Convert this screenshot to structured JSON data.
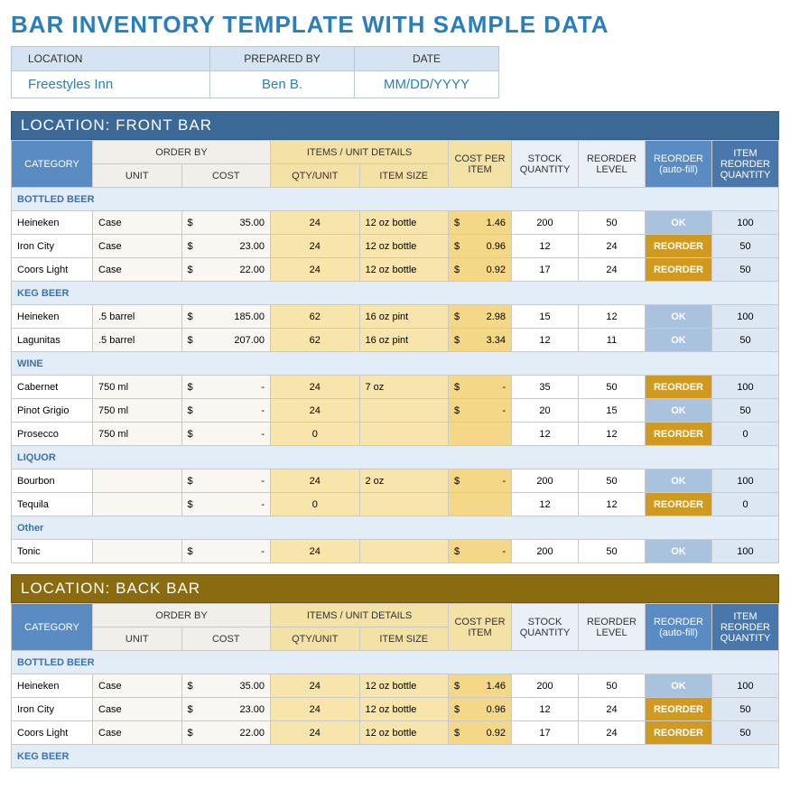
{
  "title": "BAR INVENTORY TEMPLATE WITH SAMPLE DATA",
  "meta": {
    "headers": {
      "location": "LOCATION",
      "prepared": "PREPARED BY",
      "date": "DATE"
    },
    "values": {
      "location": "Freestyles Inn",
      "prepared": "Ben B.",
      "date": "MM/DD/YYYY"
    }
  },
  "cols": {
    "category": "CATEGORY",
    "orderby": "ORDER BY",
    "unit": "UNIT",
    "cost": "COST",
    "items": "ITEMS / UNIT DETAILS",
    "qtyunit": "QTY/UNIT",
    "itemsize": "ITEM SIZE",
    "costper": "COST PER ITEM",
    "stock": "STOCK QUANTITY",
    "reorder": "REORDER LEVEL",
    "auto": "REORDER (auto-fill)",
    "irq": "ITEM REORDER QUANTITY"
  },
  "status": {
    "ok": "OK",
    "reorder": "REORDER"
  },
  "currency": "$",
  "locations": [
    {
      "title": "LOCATION: FRONT BAR",
      "style": "blue",
      "groups": [
        {
          "name": "BOTTLED BEER",
          "rows": [
            {
              "name": "Heineken",
              "unit": "Case",
              "cost": "35.00",
              "qty": "24",
              "size": "12 oz bottle",
              "cpi": "1.46",
              "stock": "200",
              "rlevel": "50",
              "auto": "OK",
              "irq": "100"
            },
            {
              "name": "Iron City",
              "unit": "Case",
              "cost": "23.00",
              "qty": "24",
              "size": "12 oz bottle",
              "cpi": "0.96",
              "stock": "12",
              "rlevel": "24",
              "auto": "REORDER",
              "irq": "50"
            },
            {
              "name": "Coors Light",
              "unit": "Case",
              "cost": "22.00",
              "qty": "24",
              "size": "12 oz bottle",
              "cpi": "0.92",
              "stock": "17",
              "rlevel": "24",
              "auto": "REORDER",
              "irq": "50"
            }
          ]
        },
        {
          "name": "KEG BEER",
          "rows": [
            {
              "name": "Heineken",
              "unit": ".5 barrel",
              "cost": "185.00",
              "qty": "62",
              "size": "16 oz pint",
              "cpi": "2.98",
              "stock": "15",
              "rlevel": "12",
              "auto": "OK",
              "irq": "100"
            },
            {
              "name": "Lagunitas",
              "unit": ".5 barrel",
              "cost": "207.00",
              "qty": "62",
              "size": "16 oz pint",
              "cpi": "3.34",
              "stock": "12",
              "rlevel": "11",
              "auto": "OK",
              "irq": "50"
            }
          ]
        },
        {
          "name": "WINE",
          "rows": [
            {
              "name": "Cabernet",
              "unit": "750 ml",
              "cost": "-",
              "qty": "24",
              "size": "7 oz",
              "cpi": "-",
              "stock": "35",
              "rlevel": "50",
              "auto": "REORDER",
              "irq": "100"
            },
            {
              "name": "Pinot Grigio",
              "unit": "750 ml",
              "cost": "-",
              "qty": "24",
              "size": "",
              "cpi": "-",
              "stock": "20",
              "rlevel": "15",
              "auto": "OK",
              "irq": "50"
            },
            {
              "name": "Prosecco",
              "unit": "750 ml",
              "cost": "-",
              "qty": "0",
              "size": "",
              "cpi": "",
              "stock": "12",
              "rlevel": "12",
              "auto": "REORDER",
              "irq": "0"
            }
          ]
        },
        {
          "name": "LIQUOR",
          "rows": [
            {
              "name": "Bourbon",
              "unit": "",
              "cost": "-",
              "qty": "24",
              "size": "2 oz",
              "cpi": "-",
              "stock": "200",
              "rlevel": "50",
              "auto": "OK",
              "irq": "100"
            },
            {
              "name": "Tequila",
              "unit": "",
              "cost": "-",
              "qty": "0",
              "size": "",
              "cpi": "",
              "stock": "12",
              "rlevel": "12",
              "auto": "REORDER",
              "irq": "0"
            }
          ]
        },
        {
          "name": "Other",
          "rows": [
            {
              "name": "Tonic",
              "unit": "",
              "cost": "-",
              "qty": "24",
              "size": "",
              "cpi": "-",
              "stock": "200",
              "rlevel": "50",
              "auto": "OK",
              "irq": "100"
            }
          ]
        }
      ]
    },
    {
      "title": "LOCATION: BACK BAR",
      "style": "brown",
      "groups": [
        {
          "name": "BOTTLED BEER",
          "rows": [
            {
              "name": "Heineken",
              "unit": "Case",
              "cost": "35.00",
              "qty": "24",
              "size": "12 oz bottle",
              "cpi": "1.46",
              "stock": "200",
              "rlevel": "50",
              "auto": "OK",
              "irq": "100"
            },
            {
              "name": "Iron City",
              "unit": "Case",
              "cost": "23.00",
              "qty": "24",
              "size": "12 oz bottle",
              "cpi": "0.96",
              "stock": "12",
              "rlevel": "24",
              "auto": "REORDER",
              "irq": "50"
            },
            {
              "name": "Coors Light",
              "unit": "Case",
              "cost": "22.00",
              "qty": "24",
              "size": "12 oz bottle",
              "cpi": "0.92",
              "stock": "17",
              "rlevel": "24",
              "auto": "REORDER",
              "irq": "50"
            }
          ]
        },
        {
          "name": "KEG BEER",
          "rows": []
        }
      ]
    }
  ]
}
